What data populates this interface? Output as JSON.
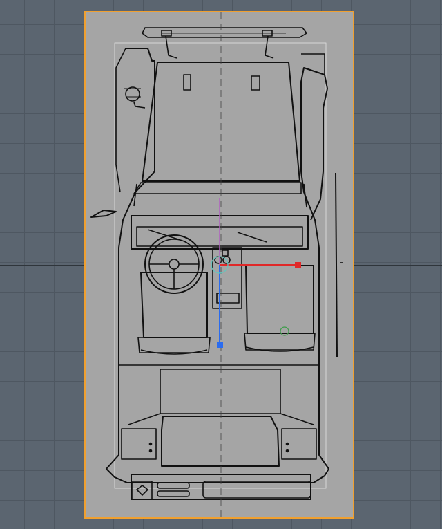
{
  "viewport": {
    "background_color": "#5b6570",
    "grid_color": "#4e5761",
    "axis_color": "#2f353b"
  },
  "reference_image": {
    "subject": "vehicle-top-view-blueprint",
    "fill_color": "#a5a5a5",
    "selection_outline_color": "#f0a030",
    "line_color": "#111111"
  },
  "gizmo": {
    "x_axis_color": "#e02828",
    "y_axis_color": "#2a6cf0",
    "z_axis_color": "#b060c0",
    "pivot_color": "#5fc8c0",
    "rotation_handle_color": "#3e9c4a"
  }
}
